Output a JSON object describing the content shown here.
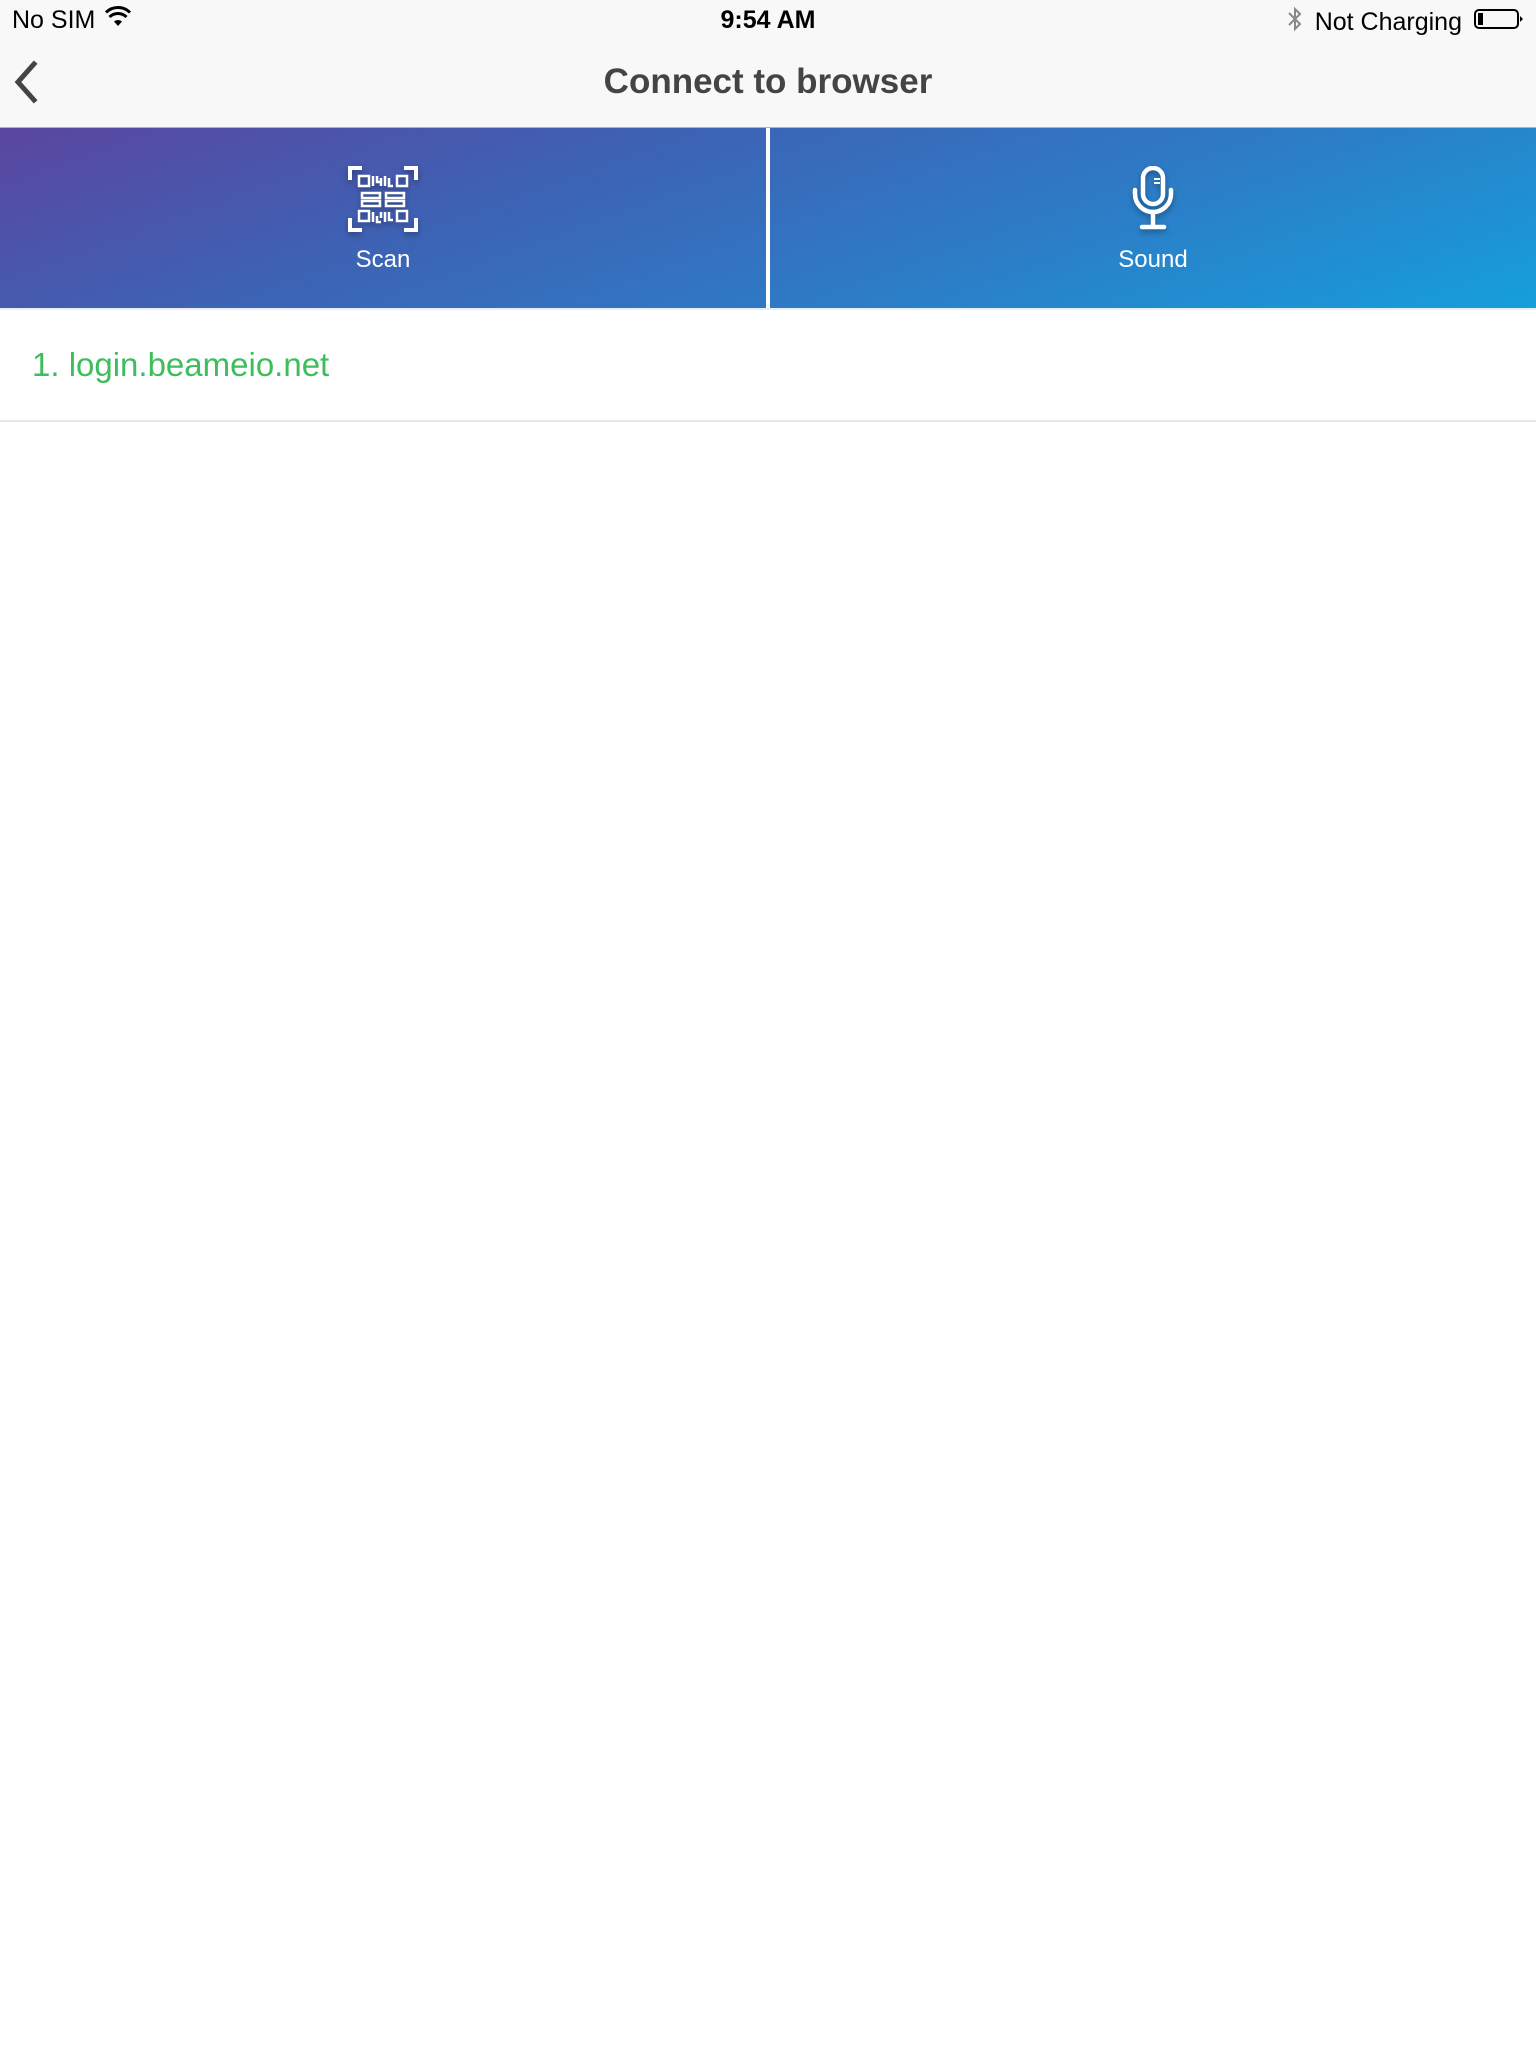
{
  "status_bar": {
    "carrier": "No SIM",
    "wifi_icon": "wifi-icon",
    "time": "9:54 AM",
    "bluetooth_icon": "bluetooth-icon",
    "charging_status": "Not Charging",
    "battery_icon": "battery-icon",
    "battery_level_percent": 10
  },
  "nav_bar": {
    "back_icon": "chevron-left-icon",
    "title": "Connect to browser"
  },
  "actions": [
    {
      "label": "Scan",
      "icon": "qr-code-icon"
    },
    {
      "label": "Sound",
      "icon": "microphone-icon"
    }
  ],
  "list": {
    "items": [
      {
        "label": "1. login.beameio.net"
      }
    ]
  },
  "colors": {
    "gradient_start": "#5a46a0",
    "gradient_end": "#159fdb",
    "list_text": "#3dbd5c",
    "title_text": "#444444",
    "nav_background": "#f8f8f8"
  }
}
